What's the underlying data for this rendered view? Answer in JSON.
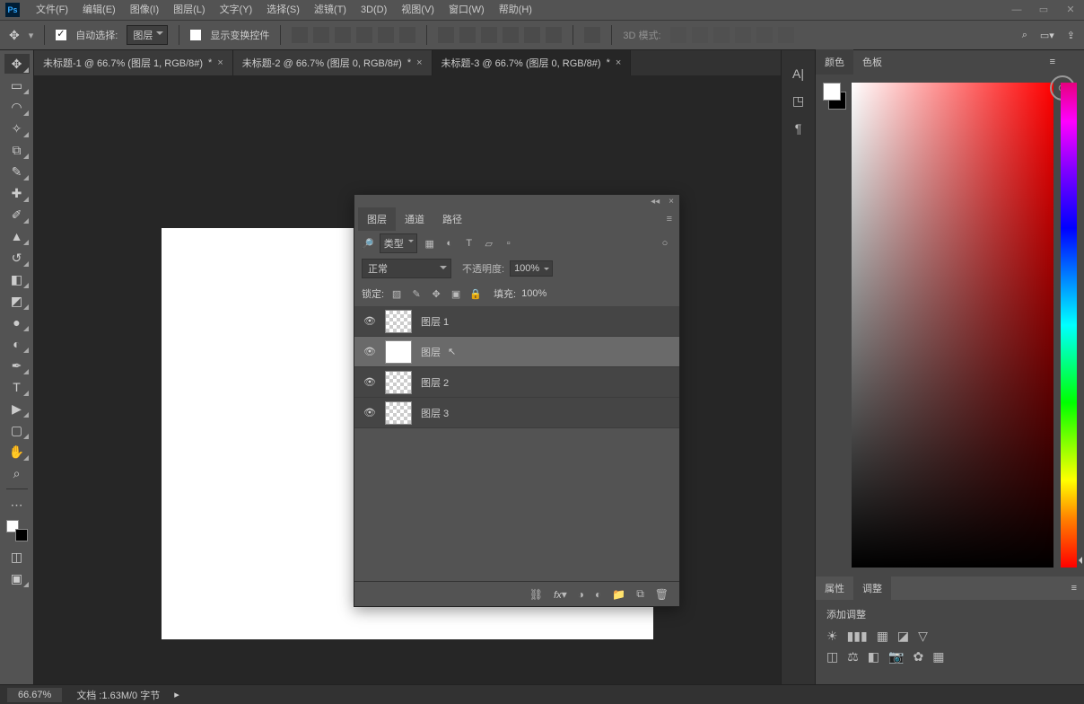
{
  "menu": {
    "items": [
      "文件(F)",
      "编辑(E)",
      "图像(I)",
      "图层(L)",
      "文字(Y)",
      "选择(S)",
      "滤镜(T)",
      "3D(D)",
      "视图(V)",
      "窗口(W)",
      "帮助(H)"
    ]
  },
  "options": {
    "auto_select_label": "自动选择:",
    "auto_select_target": "图层",
    "show_transform_label": "显示变换控件",
    "mode_3d_label": "3D 模式:"
  },
  "tabs": [
    {
      "title": "未标题-1 @ 66.7% (图层 1, RGB/8#)",
      "dirty": true,
      "active": false
    },
    {
      "title": "未标题-2 @ 66.7% (图层 0, RGB/8#)",
      "dirty": true,
      "active": false
    },
    {
      "title": "未标题-3 @ 66.7% (图层 0, RGB/8#)",
      "dirty": true,
      "active": true
    }
  ],
  "layers_panel": {
    "tabs": {
      "layers": "图层",
      "channels": "通道",
      "paths": "路径"
    },
    "filter_kind_label": "类型",
    "blend_mode": "正常",
    "opacity_label": "不透明度:",
    "opacity_value": "100%",
    "lock_label": "锁定:",
    "fill_label": "填充:",
    "fill_value": "100%",
    "layers": [
      {
        "name": "图层 1",
        "visible": true,
        "thumb": "trans",
        "selected": false
      },
      {
        "name": "图层",
        "visible": true,
        "thumb": "white",
        "selected": true
      },
      {
        "name": "图层 2",
        "visible": true,
        "thumb": "trans",
        "selected": false
      },
      {
        "name": "图层 3",
        "visible": true,
        "thumb": "trans",
        "selected": false
      }
    ]
  },
  "color_panel": {
    "tabs": {
      "color": "颜色",
      "swatches": "色板"
    }
  },
  "prop_panel": {
    "tabs": {
      "properties": "属性",
      "adjustments": "调整"
    },
    "add_adjustment_label": "添加调整"
  },
  "status": {
    "zoom": "66.67%",
    "doc_info": "文档 :1.63M/0 字节"
  }
}
